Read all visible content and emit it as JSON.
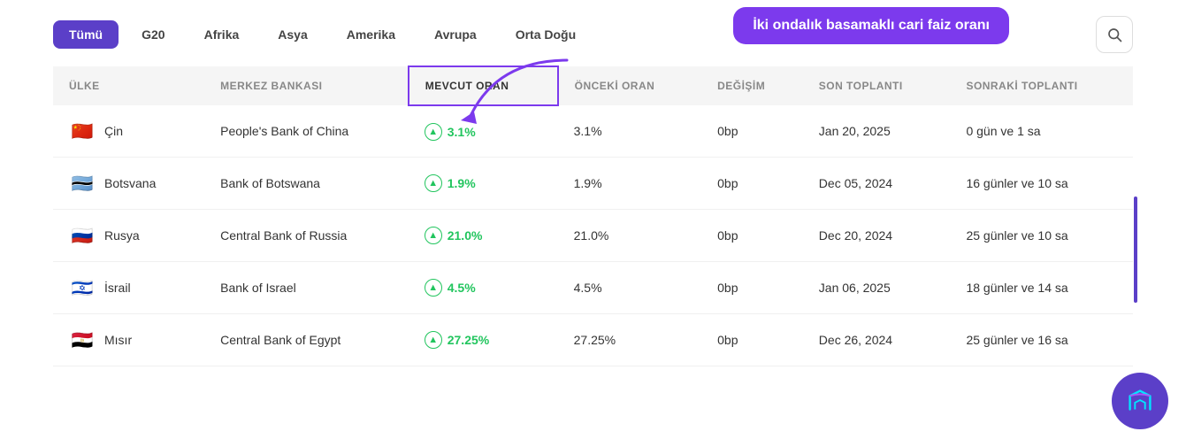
{
  "nav": {
    "items": [
      {
        "label": "Tümü",
        "active": true
      },
      {
        "label": "G20",
        "active": false
      },
      {
        "label": "Afrika",
        "active": false
      },
      {
        "label": "Asya",
        "active": false
      },
      {
        "label": "Amerika",
        "active": false
      },
      {
        "label": "Avrupa",
        "active": false
      },
      {
        "label": "Orta Doğu",
        "active": false
      }
    ]
  },
  "tooltip": "İki ondalık basamaklı cari faiz oranı",
  "search_label": "🔍",
  "columns": [
    {
      "label": "ÜLKE",
      "highlighted": false
    },
    {
      "label": "MERKEZ BANKASI",
      "highlighted": false
    },
    {
      "label": "MEVCUT ORAN",
      "highlighted": true
    },
    {
      "label": "ÖNCEKİ ORAN",
      "highlighted": false
    },
    {
      "label": "DEĞİŞİM",
      "highlighted": false
    },
    {
      "label": "SON TOPLANTI",
      "highlighted": false
    },
    {
      "label": "SONRAKİ TOPLANTI",
      "highlighted": false
    }
  ],
  "rows": [
    {
      "country": "Çin",
      "flag": "🇨🇳",
      "bank": "People's Bank of China",
      "rate": "3.1%",
      "prev_rate": "3.1%",
      "change": "0bp",
      "last_meeting": "Jan 20, 2025",
      "next_meeting": "0 gün ve 1 sa"
    },
    {
      "country": "Botsvana",
      "flag": "🇧🇼",
      "bank": "Bank of Botswana",
      "rate": "1.9%",
      "prev_rate": "1.9%",
      "change": "0bp",
      "last_meeting": "Dec 05, 2024",
      "next_meeting": "16 günler ve 10 sa"
    },
    {
      "country": "Rusya",
      "flag": "🇷🇺",
      "bank": "Central Bank of Russia",
      "rate": "21.0%",
      "prev_rate": "21.0%",
      "change": "0bp",
      "last_meeting": "Dec 20, 2024",
      "next_meeting": "25 günler ve 10 sa"
    },
    {
      "country": "İsrail",
      "flag": "🇮🇱",
      "bank": "Bank of Israel",
      "rate": "4.5%",
      "prev_rate": "4.5%",
      "change": "0bp",
      "last_meeting": "Jan 06, 2025",
      "next_meeting": "18 günler ve 14 sa"
    },
    {
      "country": "Mısır",
      "flag": "🇪🇬",
      "bank": "Central Bank of Egypt",
      "rate": "27.25%",
      "prev_rate": "27.25%",
      "change": "0bp",
      "last_meeting": "Dec 26, 2024",
      "next_meeting": "25 günler ve 16 sa"
    }
  ]
}
